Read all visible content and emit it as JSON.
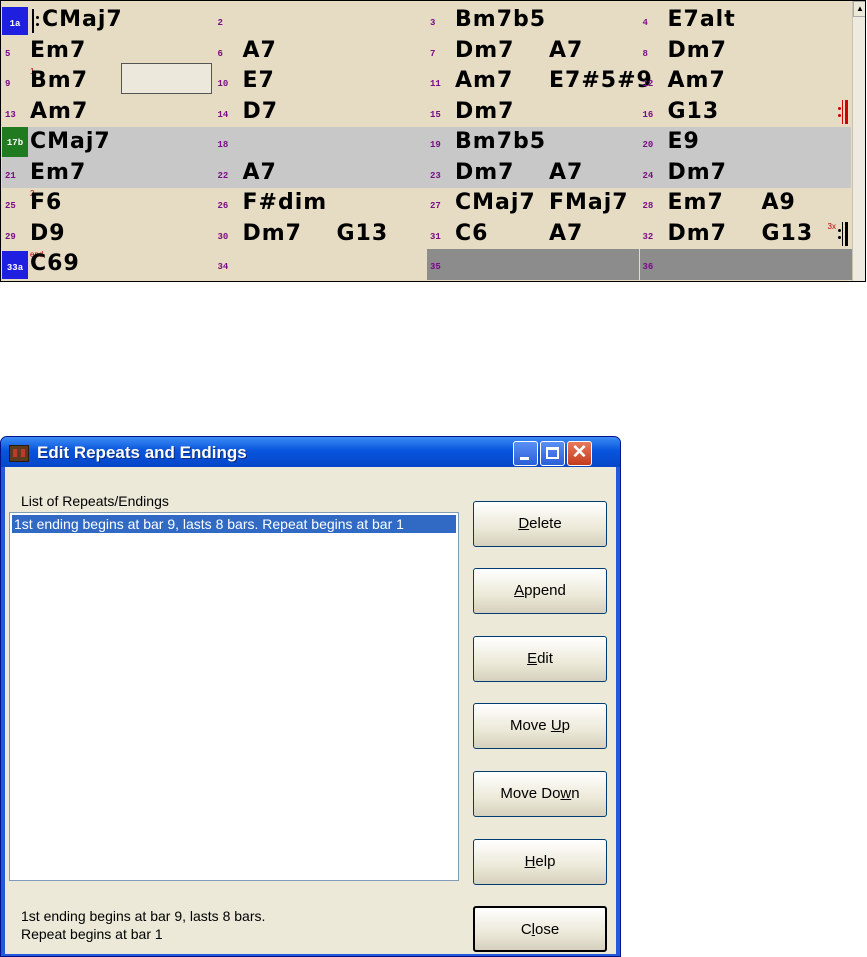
{
  "chord_sheet": {
    "rows": [
      {
        "bars": [
          {
            "num": "1a",
            "style": "blue",
            "chords": [
              "CMaj7"
            ],
            "repeat_open": true
          },
          {
            "num": "2",
            "chords": []
          },
          {
            "num": "3",
            "chords": [
              "Bm7b5"
            ]
          },
          {
            "num": "4",
            "chords": [
              "E7alt"
            ]
          }
        ]
      },
      {
        "bars": [
          {
            "num": "5",
            "chords": [
              "Em7"
            ]
          },
          {
            "num": "6",
            "chords": [
              "A7"
            ]
          },
          {
            "num": "7",
            "chords": [
              "Dm7",
              "A7"
            ]
          },
          {
            "num": "8",
            "chords": [
              "Dm7"
            ]
          }
        ]
      },
      {
        "bars": [
          {
            "num": "9",
            "mark": "1",
            "chords": [
              "Bm7"
            ]
          },
          {
            "num": "10",
            "chords": [
              "E7"
            ]
          },
          {
            "num": "11",
            "chords": [
              "Am7",
              "E7#5#9"
            ]
          },
          {
            "num": "12",
            "chords": [
              "Am7"
            ]
          }
        ]
      },
      {
        "bars": [
          {
            "num": "13",
            "chords": [
              "Am7"
            ]
          },
          {
            "num": "14",
            "chords": [
              "D7"
            ]
          },
          {
            "num": "15",
            "chords": [
              "Dm7"
            ]
          },
          {
            "num": "16",
            "chords": [
              "G13"
            ],
            "repeat_close": "red"
          }
        ]
      },
      {
        "highlight": true,
        "bars": [
          {
            "num": "17b",
            "style": "green",
            "chords": [
              "CMaj7"
            ]
          },
          {
            "num": "18",
            "chords": []
          },
          {
            "num": "19",
            "chords": [
              "Bm7b5"
            ]
          },
          {
            "num": "20",
            "chords": [
              "E9"
            ]
          }
        ]
      },
      {
        "highlight": true,
        "bars": [
          {
            "num": "21",
            "chords": [
              "Em7"
            ]
          },
          {
            "num": "22",
            "chords": [
              "A7"
            ]
          },
          {
            "num": "23",
            "chords": [
              "Dm7",
              "A7"
            ]
          },
          {
            "num": "24",
            "chords": [
              "Dm7"
            ]
          }
        ]
      },
      {
        "bars": [
          {
            "num": "25",
            "mark": "2",
            "chords": [
              "F6"
            ]
          },
          {
            "num": "26",
            "chords": [
              "F#dim"
            ]
          },
          {
            "num": "27",
            "chords": [
              "CMaj7",
              "FMaj7"
            ]
          },
          {
            "num": "28",
            "chords": [
              "Em7",
              "A9"
            ]
          }
        ]
      },
      {
        "bars": [
          {
            "num": "29",
            "chords": [
              "D9"
            ]
          },
          {
            "num": "30",
            "chords": [
              "Dm7",
              "G13"
            ]
          },
          {
            "num": "31",
            "chords": [
              "C6",
              "A7"
            ]
          },
          {
            "num": "32",
            "chords": [
              "Dm7",
              "G13"
            ],
            "mark_right": "3x",
            "repeat_close": "black"
          }
        ]
      },
      {
        "bars": [
          {
            "num": "33a",
            "style": "blue",
            "mark": "end",
            "chords": [
              "C69"
            ]
          },
          {
            "num": "34",
            "chords": []
          },
          {
            "num": "35",
            "chords": [],
            "empty": true
          },
          {
            "num": "36",
            "chords": [],
            "empty": true
          }
        ]
      }
    ]
  },
  "dialog": {
    "title": "Edit Repeats and Endings",
    "close_glyph": "✕",
    "list_label": "List of Repeats/Endings",
    "list_items": [
      "1st ending begins at bar 9, lasts 8 bars. Repeat begins at bar 1"
    ],
    "status_line1": "1st ending begins at bar 9, lasts 8 bars.",
    "status_line2": "Repeat begins at bar 1",
    "buttons": {
      "delete": {
        "pre": "",
        "key": "D",
        "post": "elete"
      },
      "append": {
        "pre": "",
        "key": "A",
        "post": "ppend"
      },
      "edit": {
        "pre": "",
        "key": "E",
        "post": "dit"
      },
      "move_up": {
        "pre": "Move ",
        "key": "U",
        "post": "p"
      },
      "move_down": {
        "pre": "Move Do",
        "key": "w",
        "post": "n"
      },
      "help": {
        "pre": "",
        "key": "H",
        "post": "elp"
      },
      "close": {
        "pre": "C",
        "key": "l",
        "post": "ose"
      }
    }
  },
  "colors": {
    "sheet_bg": "#e6dcc4",
    "highlight_row": "#c8c8c8",
    "bar_number": "#7a0e86",
    "blue_marker": "#1f1fe0",
    "green_marker": "#207a20",
    "title_blue": "#0855dd",
    "selection": "#316ac5"
  }
}
